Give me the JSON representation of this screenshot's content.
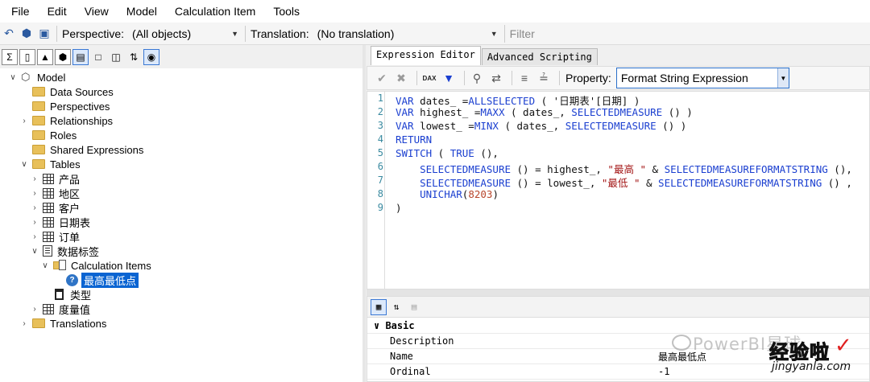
{
  "menu": {
    "items": [
      "File",
      "Edit",
      "View",
      "Model",
      "Calculation Item",
      "Tools"
    ]
  },
  "toolbar": {
    "perspective_label": "Perspective:",
    "perspective_value": "(All objects)",
    "translation_label": "Translation:",
    "translation_value": "(No translation)",
    "filter_placeholder": "Filter"
  },
  "tree": {
    "root": "Model",
    "data_sources": "Data Sources",
    "perspectives": "Perspectives",
    "relationships": "Relationships",
    "roles": "Roles",
    "shared_expressions": "Shared Expressions",
    "tables": "Tables",
    "table_items": [
      "产品",
      "地区",
      "客户",
      "日期表",
      "订单"
    ],
    "calc_table": "数据标签",
    "calc_items_folder": "Calculation Items",
    "calc_item_selected": "最高最低点",
    "column_type": "类型",
    "measure_table": "度量值",
    "translations": "Translations"
  },
  "editor": {
    "tabs": [
      "Expression Editor",
      "Advanced Scripting"
    ],
    "active_tab": "Expression Editor",
    "dax_icon_label": "DAX",
    "property_label": "Property:",
    "property_value": "Format String Expression",
    "line_numbers": [
      "1",
      "2",
      "3",
      "4",
      "5",
      "6",
      "7",
      "8",
      "9"
    ],
    "code": {
      "l1": {
        "a": "VAR",
        "b": " dates_ =",
        "c": "ALLSELECTED",
        "d": " ( '日期表'[日期] )"
      },
      "l2": {
        "a": "VAR",
        "b": " highest_ =",
        "c": "MAXX",
        "d": " ( dates_, ",
        "e": "SELECTEDMEASURE",
        "f": " () )"
      },
      "l3": {
        "a": "VAR",
        "b": " lowest_ =",
        "c": "MINX",
        "d": " ( dates_, ",
        "e": "SELECTEDMEASURE",
        "f": " () )"
      },
      "l4": {
        "a": "RETURN"
      },
      "l5": {
        "a": "SWITCH",
        "b": " ( ",
        "c": "TRUE",
        "d": " (),"
      },
      "l6": {
        "a": "    ",
        "b": "SELECTEDMEASURE",
        "c": " () = highest_, ",
        "d": "\"最高 \"",
        "e": " & ",
        "f": "SELECTEDMEASUREFORMATSTRING",
        "g": " (),"
      },
      "l7": {
        "a": "    ",
        "b": "SELECTEDMEASURE",
        "c": " () = lowest_, ",
        "d": "\"最低 \"",
        "e": " & ",
        "f": "SELECTEDMEASUREFORMATSTRING",
        "g": " () ,"
      },
      "l8": {
        "a": "    ",
        "b": "UNICHAR",
        "c": "(",
        "d": "8203",
        "e": ")"
      },
      "l9": {
        "a": ")"
      }
    }
  },
  "properties": {
    "category": "Basic",
    "rows": [
      {
        "key": "Description",
        "value": ""
      },
      {
        "key": "Name",
        "value": "最高最低点"
      },
      {
        "key": "Ordinal",
        "value": "-1"
      }
    ]
  },
  "watermark": {
    "text": "PowerBI星球",
    "logo_text": "经验啦",
    "logo_check": "✓",
    "logo_url": "jingyanla.com"
  }
}
